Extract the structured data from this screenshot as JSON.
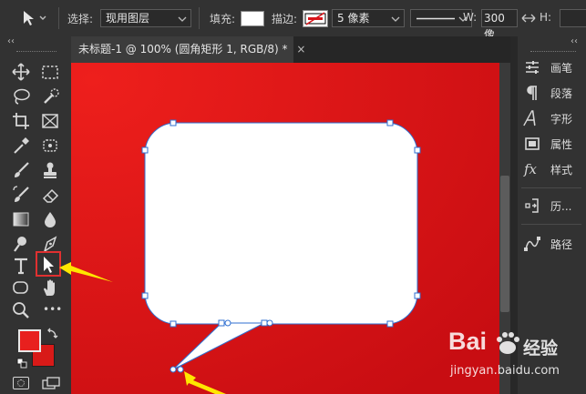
{
  "options_bar": {
    "select_label": "选择:",
    "select_value": "现用图层",
    "fill_label": "填充:",
    "stroke_label": "描边:",
    "stroke_width_value": "5 像素",
    "width_label": "W:",
    "width_value": "300 像",
    "height_label": "H:"
  },
  "document": {
    "tab_title": "未标题-1 @ 100% (圆角矩形 1, RGB/8) *",
    "close_glyph": "×",
    "canvas_color": "#d8141a",
    "shape_fill": "#ffffff",
    "selection_color": "#2f6fd1"
  },
  "toolbar": {
    "collapse_glyph": "‹‹",
    "foreground_color": "#e8201e",
    "background_color": "#d81a18",
    "highlight_color": "#e03030",
    "more_glyph": "•••"
  },
  "right_panel": {
    "collapse_glyph": "‹‹",
    "items": [
      {
        "label": "画笔",
        "icon": "brush-settings-icon"
      },
      {
        "label": "段落",
        "icon": "paragraph-icon"
      },
      {
        "label": "字形",
        "icon": "glyphs-icon"
      },
      {
        "label": "属性",
        "icon": "properties-icon"
      },
      {
        "label": "样式",
        "icon": "styles-fx-icon"
      },
      {
        "label": "历...",
        "icon": "history-icon"
      },
      {
        "label": "路径",
        "icon": "paths-icon"
      }
    ]
  },
  "annotations": {
    "arrow_color": "#ffe600"
  },
  "watermark": {
    "brand": "Bai",
    "brand_tail": "经验",
    "url": "jingyan.baidu.com"
  }
}
